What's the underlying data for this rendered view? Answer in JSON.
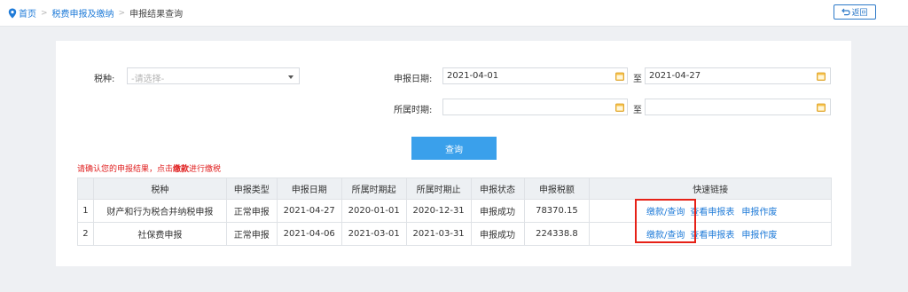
{
  "breadcrumb": {
    "home": "首页",
    "level1": "税费申报及缴纳",
    "current": "申报结果查询"
  },
  "header": {
    "back_label": "返回"
  },
  "form": {
    "tax_type_label": "税种:",
    "tax_type_placeholder": "-请选择-",
    "declare_date_label": "申报日期:",
    "declare_date_from": "2021-04-01",
    "declare_date_to": "2021-04-27",
    "period_label": "所属时期:",
    "period_from": "",
    "period_to": "",
    "to_label": "至",
    "query_label": "查询"
  },
  "notice": {
    "prefix": "请确认您的申报结果，点击",
    "highlight": "缴款",
    "suffix": "进行缴税"
  },
  "table": {
    "headers": [
      "",
      "税种",
      "申报类型",
      "申报日期",
      "所属时期起",
      "所属时期止",
      "申报状态",
      "申报税额",
      "快速链接"
    ],
    "rows": [
      [
        "1",
        "财产和行为税合并纳税申报",
        "正常申报",
        "2021-04-27",
        "2020-01-01",
        "2020-12-31",
        "申报成功",
        "78370.15"
      ],
      [
        "2",
        "社保费申报",
        "正常申报",
        "2021-04-06",
        "2021-03-01",
        "2021-03-31",
        "申报成功",
        "224338.8"
      ]
    ],
    "links": {
      "pay_query": "缴款/查询",
      "view_form": "查看申报表",
      "cancel": "申报作废"
    }
  },
  "colors": {
    "accent": "#1f7bd8",
    "button": "#3aa0eb",
    "warning": "#e02020",
    "highlight_box": "#e62117"
  }
}
